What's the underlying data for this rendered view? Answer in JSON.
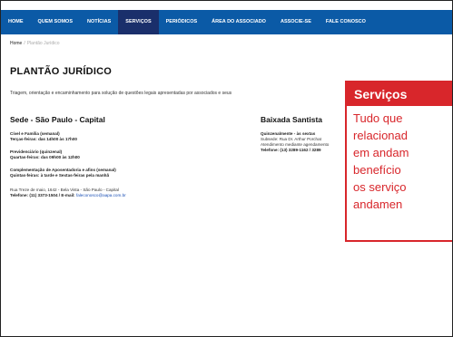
{
  "nav": {
    "items": [
      {
        "label": "HOME",
        "active": false
      },
      {
        "label": "QUEM SOMOS",
        "active": false
      },
      {
        "label": "NOTÍCIAS",
        "active": false
      },
      {
        "label": "SERVIÇOS",
        "active": true
      },
      {
        "label": "PERIÓDICOS",
        "active": false
      },
      {
        "label": "ÁREA DO ASSOCIADO",
        "active": false
      },
      {
        "label": "ASSOCIE-SE",
        "active": false
      },
      {
        "label": "FALE CONOSCO",
        "active": false
      }
    ]
  },
  "breadcrumb": {
    "home": "Home",
    "separator": "/",
    "current": "Plantão Jurídico"
  },
  "page": {
    "title": "PLANTÃO JURÍDICO",
    "intro": "Triagem, orientação e encaminhamento para solução de questões legais apresentadas por associados e seus"
  },
  "sede": {
    "heading": "Sede - São Paulo - Capital",
    "civil_label": "Cível e Família (semanal)",
    "civil_text": "Terças-feiras: das 14h00 às 17h00",
    "prev_label": "Previdenciário (quinzenal)",
    "prev_text": "Quartas-feiras: das 09h00 às 12h00",
    "comp_label": "Complementação de Aposentadoria e afins (semanal)",
    "comp_text": "Quintas-feiras: à tarde e Sextas-feiras pela manhã",
    "address": "Rua Treze de maio, 1642 - Bela Vista - São Paulo - Capital",
    "phone_prefix": "Telefone: (11) 3373-1504 / E-mail:",
    "email": "faleconosco@aapa.com.br"
  },
  "baixada": {
    "heading": "Baixada Santista",
    "label": "Quinzenalmente - às sextas",
    "line1": "Subsede: Rua Dr. Arthur Porchat",
    "line2": "Atendimento mediante agendamento",
    "line3": "Telefone: (13) 3289-1162 / 3289"
  },
  "card": {
    "title": "Serviços",
    "lines": [
      "Tudo que",
      "relacionad",
      "em andam",
      "benefício",
      "os serviço",
      "andamen"
    ]
  },
  "colors": {
    "nav_bg": "#0b5aa6",
    "nav_active": "#1a2f6b",
    "accent": "#d8262b"
  }
}
